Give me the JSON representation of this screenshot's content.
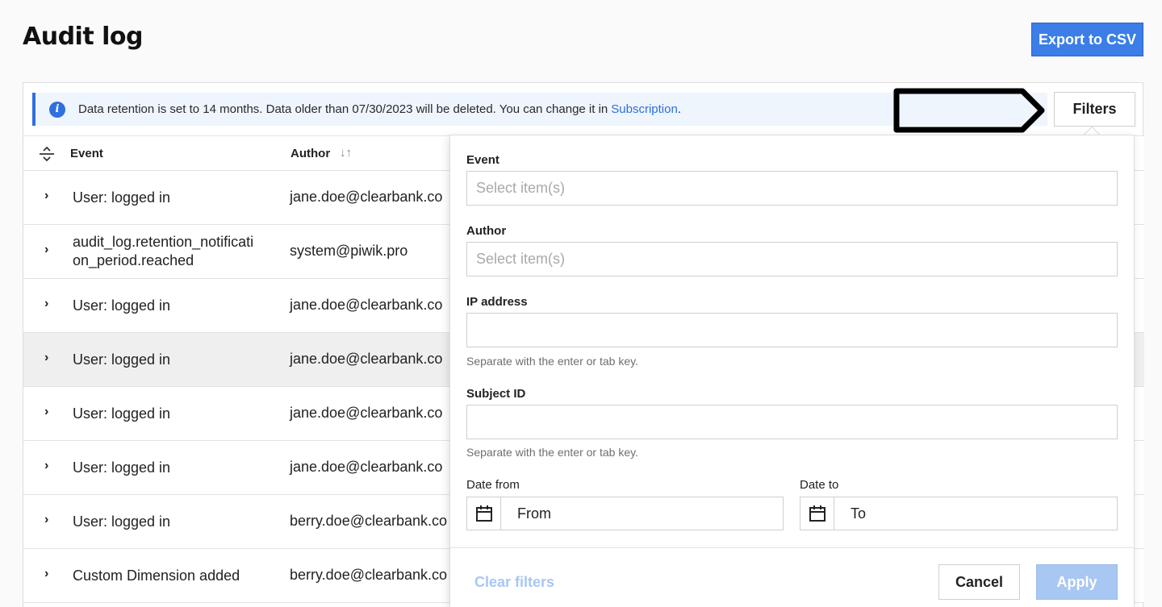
{
  "page": {
    "title": "Audit log"
  },
  "header": {
    "export_label": "Export to CSV"
  },
  "banner": {
    "text": "Data retention is set to 14 months. Data older than 07/30/2023 will be deleted. You can change it in ",
    "link": "Subscription",
    "suffix": "."
  },
  "toolbar": {
    "filters_label": "Filters"
  },
  "table": {
    "columns": {
      "event": "Event",
      "author": "Author"
    },
    "rows": [
      {
        "event": "User: logged in",
        "author": "jane.doe@clearbank.co"
      },
      {
        "event": "audit_log.retention_notification_period.reached",
        "author": "system@piwik.pro"
      },
      {
        "event": "User: logged in",
        "author": "jane.doe@clearbank.co"
      },
      {
        "event": "User: logged in",
        "author": "jane.doe@clearbank.co"
      },
      {
        "event": "User: logged in",
        "author": "jane.doe@clearbank.co"
      },
      {
        "event": "User: logged in",
        "author": "jane.doe@clearbank.co"
      },
      {
        "event": "User: logged in",
        "author": "berry.doe@clearbank.co"
      },
      {
        "event": "Custom Dimension added",
        "author": "berry.doe@clearbank.co"
      }
    ]
  },
  "filters": {
    "event": {
      "label": "Event",
      "placeholder": "Select item(s)"
    },
    "author": {
      "label": "Author",
      "placeholder": "Select item(s)"
    },
    "ip": {
      "label": "IP address",
      "hint": "Separate with the enter or tab key."
    },
    "subject": {
      "label": "Subject ID",
      "hint": "Separate with the enter or tab key."
    },
    "date_from": {
      "label": "Date from",
      "value": "From"
    },
    "date_to": {
      "label": "Date to",
      "value": "To"
    },
    "clear_label": "Clear filters",
    "cancel_label": "Cancel",
    "apply_label": "Apply"
  },
  "colors": {
    "accent": "#3b7ee8",
    "accent_disabled": "#a8c7f2",
    "banner_bg": "#eef5fd"
  }
}
